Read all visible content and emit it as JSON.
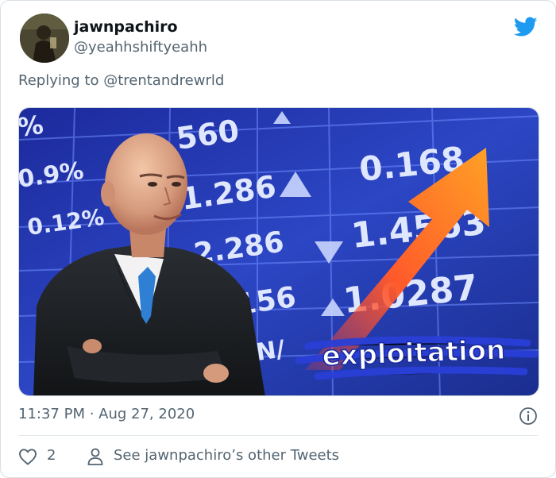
{
  "tweet": {
    "display_name": "jawnpachiro",
    "handle": "@yeahhshiftyeahh",
    "reply_prefix": "Replying to ",
    "reply_mention": "@trentandrewrld",
    "timestamp": "11:37 PM · Aug 27, 2020",
    "like_count": "2",
    "profile_link": "See jawnpachiro’s other Tweets"
  },
  "media": {
    "board_values": [
      "%",
      "0.9%",
      "0.12%",
      "560",
      "1.286",
      "2.286",
      "0.168",
      "1.4563",
      ".156",
      "1.0287",
      "N/"
    ],
    "caption": "exploitation"
  },
  "icons": {
    "bird": "twitter-bird-icon",
    "info": "info-icon",
    "like": "heart-icon",
    "profile": "person-icon"
  },
  "colors": {
    "twitter_blue": "#1d9bf0",
    "secondary_text": "#536471",
    "board_blue": "#2438b0"
  }
}
